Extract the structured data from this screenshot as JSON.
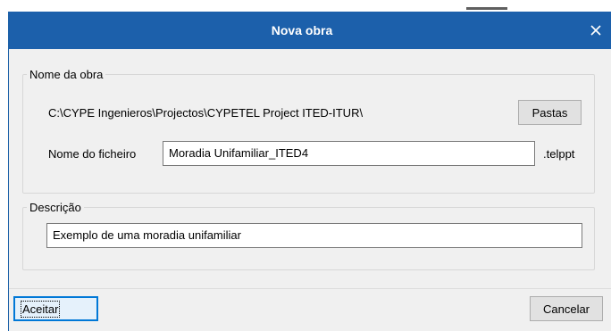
{
  "dialog": {
    "title": "Nova obra",
    "close_icon": "close-icon"
  },
  "project_group": {
    "legend": "Nome da obra",
    "path": "C:\\CYPE Ingenieros\\Projectos\\CYPETEL Project ITED-ITUR\\",
    "folders_button": "Pastas",
    "filename_label": "Nome do ficheiro",
    "filename_value": "Moradia Unifamiliar_ITED4",
    "extension": ".telppt"
  },
  "description_group": {
    "legend": "Descrição",
    "value": "Exemplo de uma moradia unifamiliar"
  },
  "footer": {
    "accept_button": "Aceitar",
    "cancel_button": "Cancelar"
  },
  "colors": {
    "titlebar": "#1c60ab",
    "dialog_bg": "#f0f0f0",
    "focus_border": "#0078d7"
  }
}
